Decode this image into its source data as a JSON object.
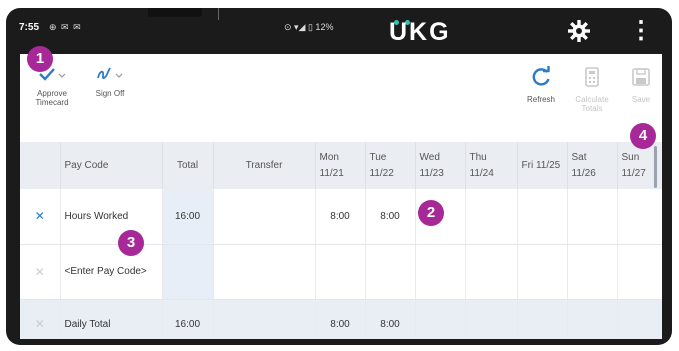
{
  "status_bar": {
    "time": "7:55",
    "left_icons": "⊕ ✉ ✉",
    "right_icons": "⊙ ▾◢ ▯ 12%",
    "brand": "UKG"
  },
  "toolbar": {
    "approve_label": "Approve Timecard",
    "signoff_label": "Sign Off",
    "refresh_label": "Refresh",
    "calculate_label": "Calculate Totals",
    "save_label": "Save"
  },
  "table": {
    "headers": {
      "pay_code": "Pay Code",
      "total": "Total",
      "transfer": "Transfer",
      "mon_day": "Mon",
      "mon_date": "11/21",
      "tue_day": "Tue",
      "tue_date": "11/22",
      "wed_day": "Wed",
      "wed_date": "11/23",
      "thu_day": "Thu",
      "thu_date": "11/24",
      "fri": "Fri 11/25",
      "sat_day": "Sat",
      "sat_date": "11/26",
      "sun_day": "Sun",
      "sun_date": "11/27"
    },
    "rows": [
      {
        "remove": "✕",
        "pay_code": "Hours Worked",
        "total": "16:00",
        "transfer": "",
        "mon": "8:00",
        "tue": "8:00",
        "wed": "",
        "thu": "",
        "fri": "",
        "sat": "",
        "sun": ""
      },
      {
        "remove": "✕",
        "pay_code": "<Enter Pay Code>",
        "total": "",
        "transfer": "",
        "mon": "",
        "tue": "",
        "wed": "",
        "thu": "",
        "fri": "",
        "sat": "",
        "sun": ""
      }
    ],
    "daily_total": {
      "remove": "✕",
      "label": "Daily Total",
      "total": "16:00",
      "mon": "8:00",
      "tue": "8:00"
    }
  },
  "callouts": [
    "1",
    "2",
    "3",
    "4"
  ],
  "colors": {
    "accent_blue": "#2b7bc9",
    "callout": "#a72897",
    "brand_teal": "#2ec4b6"
  }
}
